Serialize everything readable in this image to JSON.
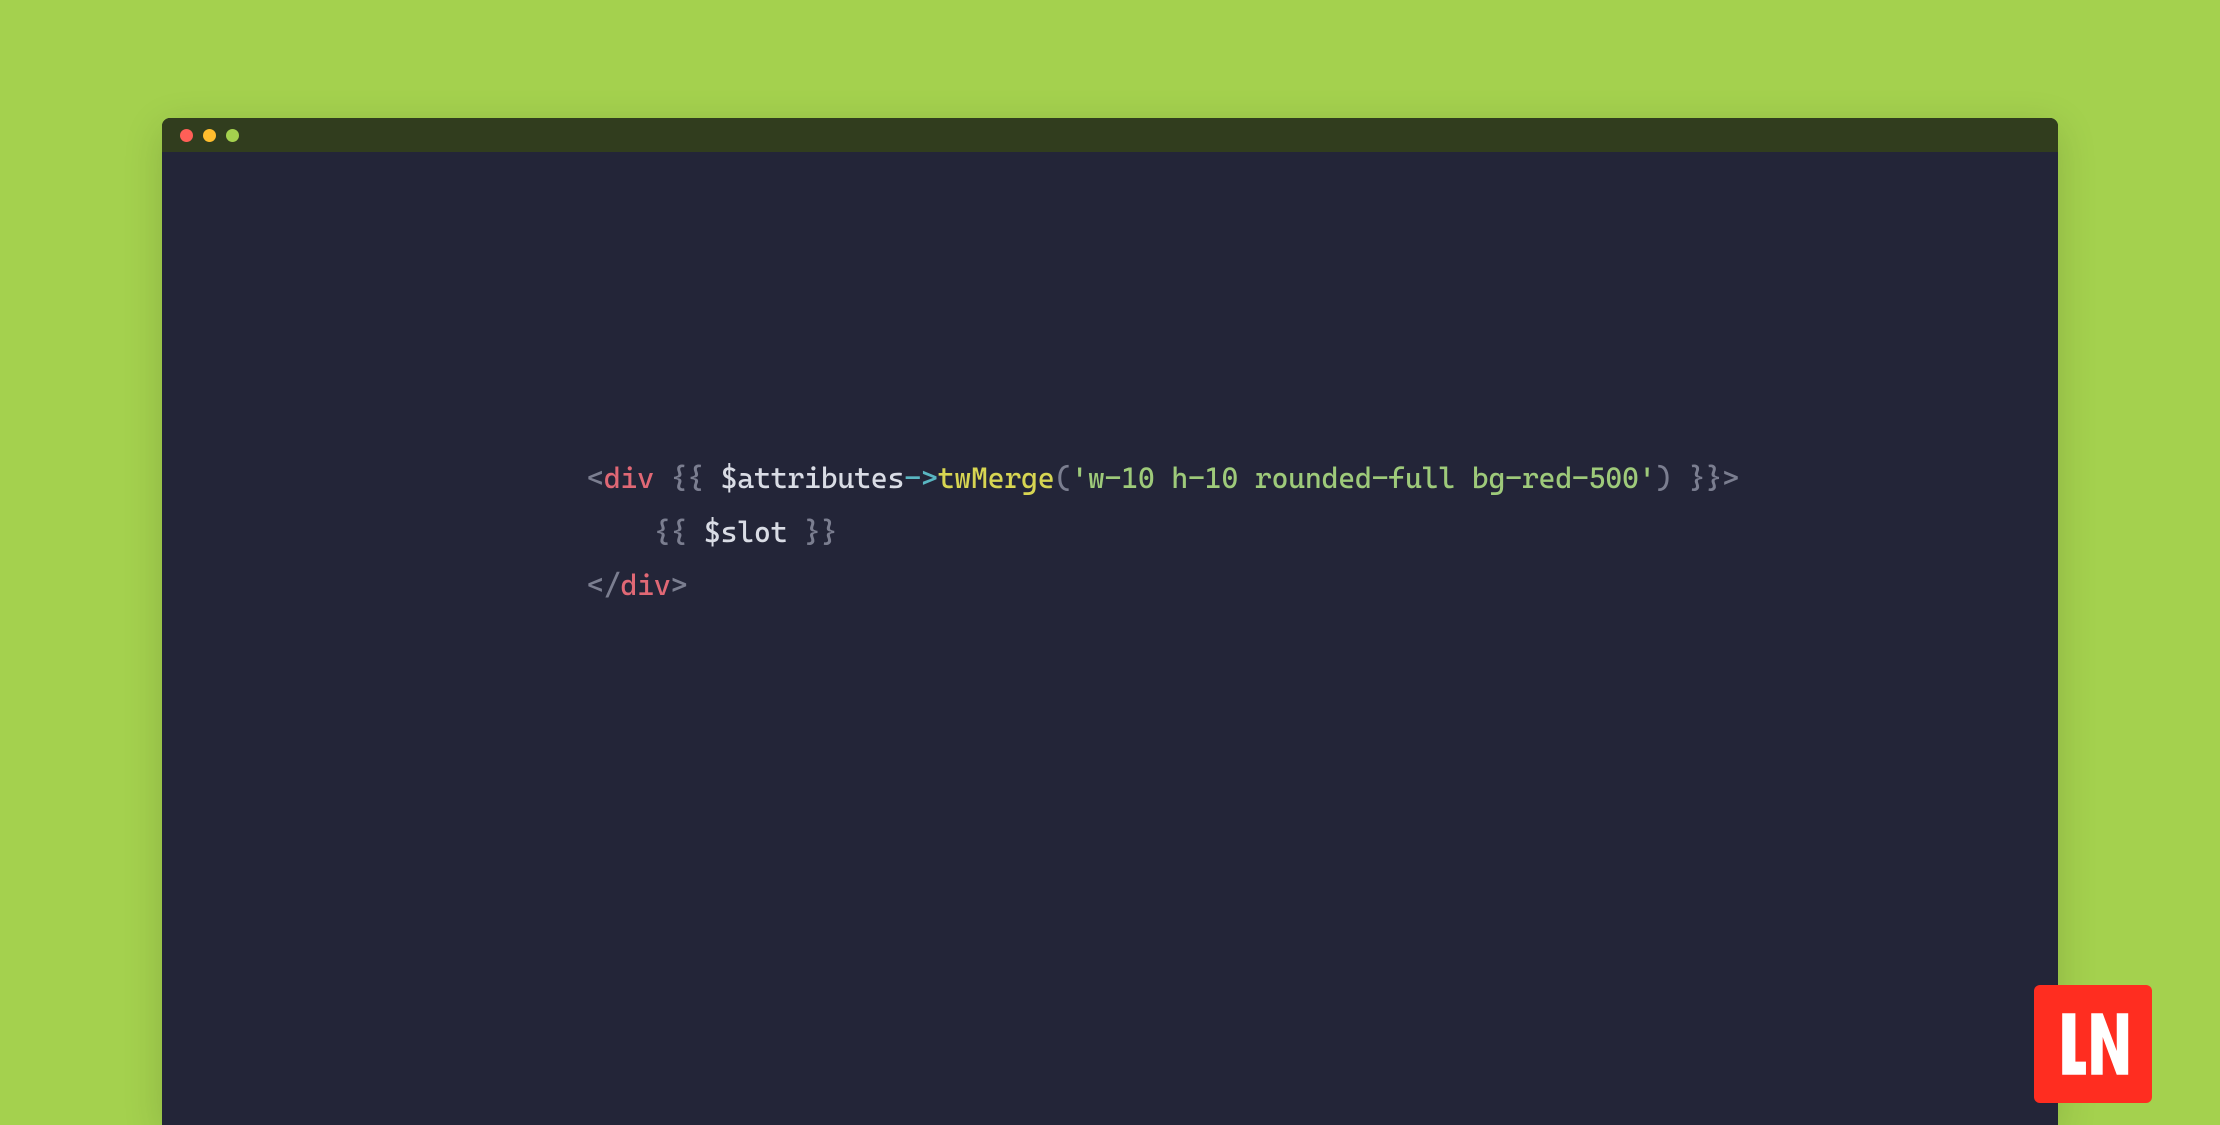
{
  "code": {
    "line1": {
      "open_bracket": "<",
      "tag": "div",
      "space": " ",
      "curly_open": "{{ ",
      "var": "$attributes",
      "arrow": "->",
      "method": "twMerge",
      "paren_open": "(",
      "string": "'w-10 h-10 rounded-full bg-red-500'",
      "paren_close": ")",
      "curly_close": " }}",
      "close_bracket": ">"
    },
    "line2": {
      "indent": "    ",
      "curly_open": "{{ ",
      "var": "$slot",
      "curly_close": " }}"
    },
    "line3": {
      "open_bracket": "</",
      "tag": "div",
      "close_bracket": ">"
    }
  },
  "logo": {
    "text": "LN"
  }
}
